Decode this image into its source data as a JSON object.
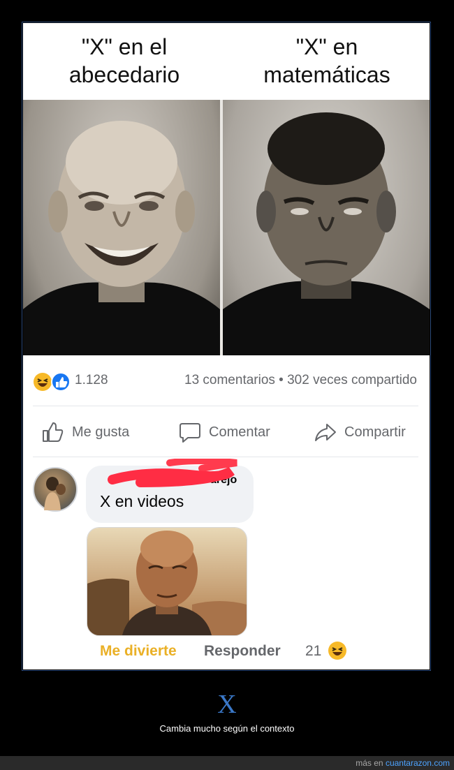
{
  "meme": {
    "left_caption_line1": "\"X\" en el",
    "left_caption_line2": "abecedario",
    "right_caption_line1": "\"X\" en",
    "right_caption_line2": "matemáticas"
  },
  "post": {
    "reaction_count": "1.128",
    "comments_and_shares": "13 comentarios • 302 veces compartido",
    "actions": {
      "like": "Me gusta",
      "comment": "Comentar",
      "share": "Compartir"
    }
  },
  "comment": {
    "author_visible_fragment": "arejo",
    "text": "X en videos",
    "reaction_label": "Me divierte",
    "reply_label": "Responder",
    "reaction_count": "21"
  },
  "footer": {
    "title": "X",
    "caption": "Cambia mucho según el contexto",
    "more_prefix": "más en ",
    "site": "cuantarazon.com"
  },
  "colors": {
    "facebook_blue": "#1877f2",
    "haha_yellow": "#f7b928",
    "link_blue": "#4da3ff",
    "x_blue": "#3a78c8"
  }
}
